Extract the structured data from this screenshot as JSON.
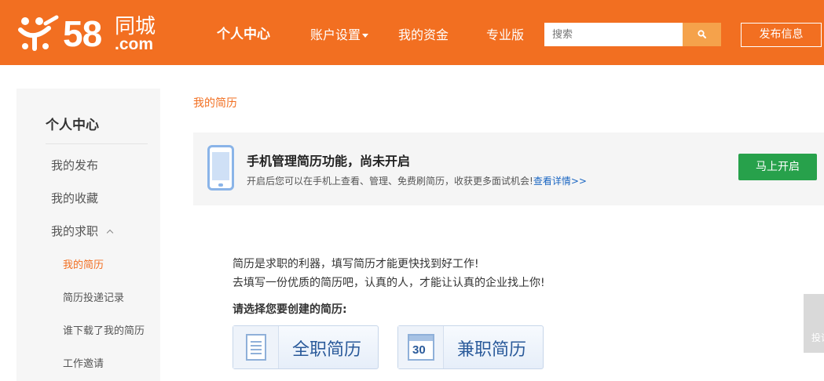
{
  "header": {
    "logo_number": "58",
    "logo_brand": "同城",
    "logo_domain": ".com",
    "nav": [
      "个人中心",
      "账户设置",
      "我的资金",
      "专业版"
    ],
    "search_placeholder": "搜索",
    "publish_label": "发布信息",
    "brand_color": "#f26f21"
  },
  "sidebar": {
    "title": "个人中心",
    "items": [
      "我的发布",
      "我的收藏",
      "我的求职"
    ],
    "sub_items": [
      "我的简历",
      "简历投递记录",
      "谁下载了我的简历",
      "工作邀请"
    ],
    "active_sub": "我的简历"
  },
  "main": {
    "page_title": "我的简历",
    "notice": {
      "title": "手机管理简历功能，尚未开启",
      "desc": "开启后您可以在手机上查看、管理、免费刷简历，收获更多面试机会!",
      "link": "查看详情>>",
      "button": "马上开启"
    },
    "intro_lines": [
      "简历是求职的利器，填写简历才能更快找到好工作!",
      "去填写一份优质的简历吧，认真的人，才能让认真的企业找上你!"
    ],
    "choose_label": "请选择您要创建的简历:",
    "resume_options": [
      {
        "label": "全职简历",
        "icon": "document-icon"
      },
      {
        "label": "兼职简历",
        "icon": "calendar-icon",
        "icon_text": "30"
      }
    ]
  },
  "float_tab": {
    "label": "投诉"
  }
}
